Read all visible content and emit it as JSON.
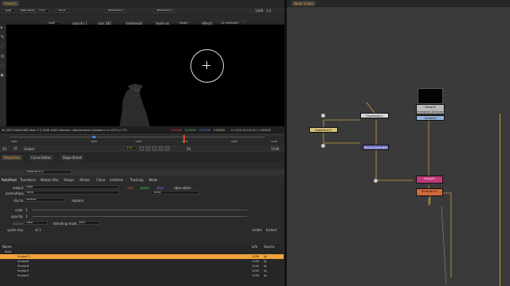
{
  "viewer": {
    "panel_tab": "Viewer1",
    "top_row": [
      "rgba",
      "rgba.alpha",
      "RGB",
      "sRGB",
      "VectorBlur2",
      "VectorBlur2"
    ],
    "frame_readout": "1409",
    "zoom": "1:1",
    "mode": "2D",
    "paint_toolbar": {
      "source": "over",
      "opacity_label": "opacity",
      "opacity": "1",
      "size_label": "size",
      "size": "182",
      "hardness_label": "hardness",
      "hardness": "0",
      "buildup_label": "build up",
      "single": "single",
      "effect_label": "effect",
      "effect": "1",
      "selection": "on selection"
    },
    "info_line": "2K_DCP 2048x1080  bbox: 0 0 2048 1080 channels: rgba,forward.u,forward.v  x=1572 y=773",
    "pixel_values": [
      "0.00000",
      "0.00000",
      "0.00000",
      "0.00000"
    ],
    "hsv_readout": "H: 0 S:0.00 V:0.00  L: 0.00000",
    "timeline": {
      "fps": "24",
      "tf": "TF",
      "global": "Global",
      "frame": "1092",
      "start": "1001",
      "end": "1100",
      "step": "10",
      "tick_labels": [
        "1001",
        "1030",
        "1050",
        "1070",
        "1090",
        "1100"
      ]
    }
  },
  "tabs_bottom": [
    "Properties",
    "Curve Editor",
    "Dope Sheet"
  ],
  "properties": {
    "node_name": "RotoPaint13",
    "node_tabs": [
      "RotoPaint",
      "Transform",
      "Motion Blur",
      "Shape",
      "Stroke",
      "Clone",
      "Lifetime",
      "Tracking",
      "Node"
    ],
    "output_label": "output",
    "output_value": "rgba",
    "output_checks": [
      "red",
      "green",
      "blue",
      "rgba.alpha"
    ],
    "premultiply_label": "premultiply",
    "premultiply_value": "none",
    "premultiply_right": "none",
    "clip_label": "clip to",
    "clip_value": "format",
    "replace_label": "replace",
    "color_label": "color",
    "color_value": "1",
    "opacity_label": "opacity",
    "opacity_value": "1",
    "source_label": "source",
    "source_value": "color",
    "blending_label": "blending mode",
    "blending_value": "over",
    "spline_key_label": "spline key",
    "spline_key_value": "of 1",
    "visible_label": "visible",
    "locked_label": "locked",
    "tree_headers": [
      "Name",
      "Life",
      "Source"
    ],
    "tree_rows": [
      {
        "name": "Root",
        "life": "",
        "source": ""
      },
      {
        "name": "Smear17",
        "life": "1050",
        "source": "fg"
      },
      {
        "name": "Smear8",
        "life": "1050",
        "source": "fg"
      },
      {
        "name": "Smear8",
        "life": "1050",
        "source": "fg"
      },
      {
        "name": "Smear9",
        "life": "1050",
        "source": "fg"
      },
      {
        "name": "Smear9",
        "life": "1050",
        "source": "fg"
      }
    ]
  },
  "node_graph": {
    "tab": "Node Graph",
    "nodes": {
      "expression": "Expression1",
      "read": "Read19",
      "read_sub": "character.1000.exr",
      "grade": "Grade20",
      "roto": "RotoPaint13",
      "vector": "VectorBlur2",
      "vector_generator": "VectorGenerator",
      "merge": "Merge9"
    }
  }
}
